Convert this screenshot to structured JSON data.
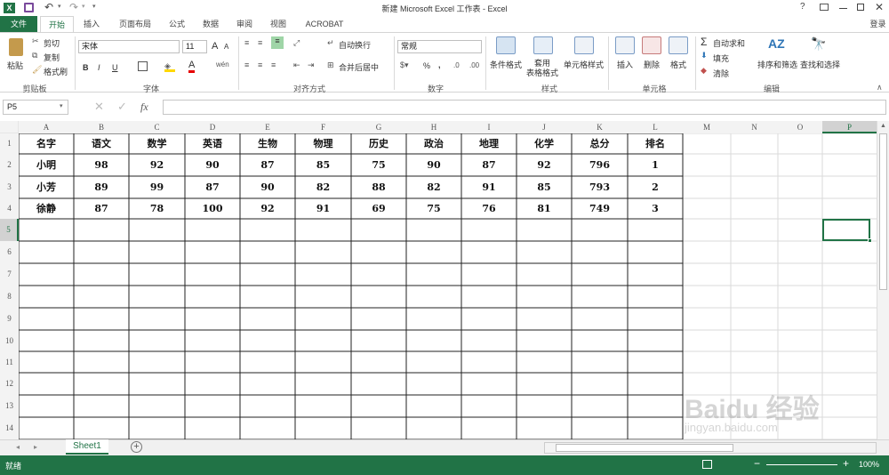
{
  "window": {
    "title": "新建 Microsoft Excel 工作表 - Excel",
    "help": "?",
    "login": "登录"
  },
  "tabs": [
    "文件",
    "开始",
    "插入",
    "页面布局",
    "公式",
    "数据",
    "审阅",
    "视图",
    "ACROBAT"
  ],
  "ribbon": {
    "clipboard": {
      "paste": "粘贴",
      "cut": "剪切",
      "copy": "复制",
      "format_painter": "格式刷",
      "label": "剪贴板"
    },
    "font": {
      "name": "宋体",
      "size": "11",
      "bold": "B",
      "italic": "I",
      "underline": "U",
      "grow": "A",
      "shrink": "A",
      "label": "字体"
    },
    "align": {
      "wrap": "自动换行",
      "merge": "合并后居中",
      "label": "对齐方式"
    },
    "number": {
      "format": "常规",
      "percent": "%",
      "comma": ",",
      "label": "数字"
    },
    "styles": {
      "cond": "条件格式",
      "table": "套用\n表格格式",
      "cell": "单元格样式",
      "label": "样式"
    },
    "cells": {
      "insert": "插入",
      "delete": "删除",
      "format": "格式",
      "label": "单元格"
    },
    "editing": {
      "autosum": "自动求和",
      "fill": "填充",
      "clear": "清除",
      "sort": "排序和筛选",
      "find": "查找和选择",
      "label": "编辑"
    }
  },
  "formula_bar": {
    "name_box": "P5",
    "fx": "fx",
    "value": ""
  },
  "columns": [
    "A",
    "B",
    "C",
    "D",
    "E",
    "F",
    "G",
    "H",
    "I",
    "J",
    "K",
    "L",
    "M",
    "N",
    "O",
    "P"
  ],
  "rows": [
    "1",
    "2",
    "3",
    "4",
    "5",
    "6",
    "7",
    "8",
    "9",
    "10",
    "11",
    "12",
    "13",
    "14"
  ],
  "table": {
    "header": [
      "名字",
      "语文",
      "数学",
      "英语",
      "生物",
      "物理",
      "历史",
      "政治",
      "地理",
      "化学",
      "总分",
      "排名"
    ],
    "data": [
      [
        "小明",
        "98",
        "92",
        "90",
        "87",
        "85",
        "75",
        "90",
        "87",
        "92",
        "796",
        "1"
      ],
      [
        "小芳",
        "89",
        "99",
        "87",
        "90",
        "82",
        "88",
        "82",
        "91",
        "85",
        "793",
        "2"
      ],
      [
        "徐静",
        "87",
        "78",
        "100",
        "92",
        "91",
        "69",
        "75",
        "76",
        "81",
        "749",
        "3"
      ]
    ]
  },
  "sheet_tab": "Sheet1",
  "status": {
    "ready": "就绪",
    "zoom": "100%"
  },
  "watermark": {
    "brand": "Baidu 经验",
    "url": "jingyan.baidu.com"
  },
  "colors": {
    "excel_green": "#217346",
    "selection": "#217346"
  }
}
